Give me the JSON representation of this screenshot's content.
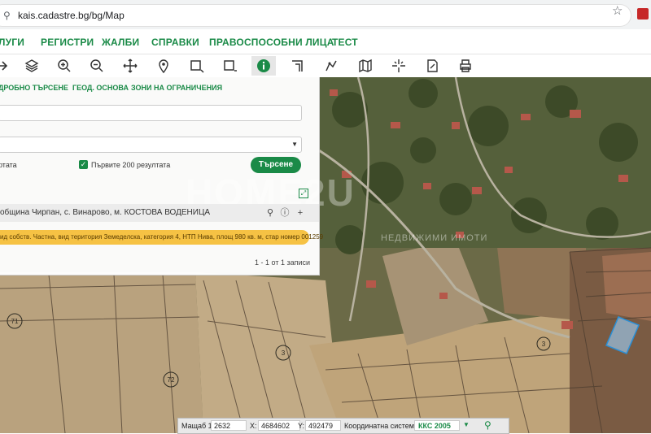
{
  "browser": {
    "url": "kais.cadastre.bg/bg/Map"
  },
  "menu": {
    "items": [
      "ЛУГИ",
      "РЕГИСТРИ",
      "ЖАЛБИ",
      "СПРАВКИ",
      "ПРАВОСПОСОБНИ ЛИЦА",
      "ТЕСТ"
    ]
  },
  "toolbar": {
    "tools": [
      "layers-icon",
      "zoom-in-icon",
      "zoom-out-icon",
      "pan-icon",
      "pin-icon",
      "select-rect-icon",
      "measure-rect-icon",
      "info-icon",
      "angle-icon",
      "draw-icon",
      "map-icon",
      "cross-icon",
      "edit-icon",
      "print-icon"
    ],
    "active_tool": "info-icon"
  },
  "panel": {
    "tabs": [
      "ДРОБНО ТЪРСЕНЕ",
      "ГЕОД. ОСНОВА",
      "ЗОНИ НА ОГРАНИЧЕНИЯ"
    ],
    "input_value": "",
    "select_value": "",
    "results_label": "ртата",
    "first200_label": "Първите 200 резултата",
    "first200_checked": true,
    "search_button": "Търсене",
    "result_header": "община Чирпан, с. Винарово, м. КОСТОВА ВОДЕНИЦА",
    "result_row": "ид собств. Частна, вид територия Земеделска, категория 4, НТП Нива, площ 980 кв. м, стар номер 001259",
    "pager": "1 - 1 от 1 записи"
  },
  "statusbar": {
    "scale_label": "Мащаб 1:",
    "scale_value": "2632",
    "x_label": "X:",
    "x_value": "4684602",
    "y_label": "Y:",
    "y_value": "492479",
    "crs_label": "Координатна система:",
    "crs_value": "ККС 2005"
  },
  "map_labels": [
    "71",
    "72",
    "3",
    "3"
  ],
  "watermark": "HOME2U",
  "watermark_sub": "НЕДВИЖИМИ ИМОТИ",
  "colors": {
    "accent": "#1a8a47",
    "highlight": "#f6c244",
    "parcel": "#9fd3ff"
  }
}
